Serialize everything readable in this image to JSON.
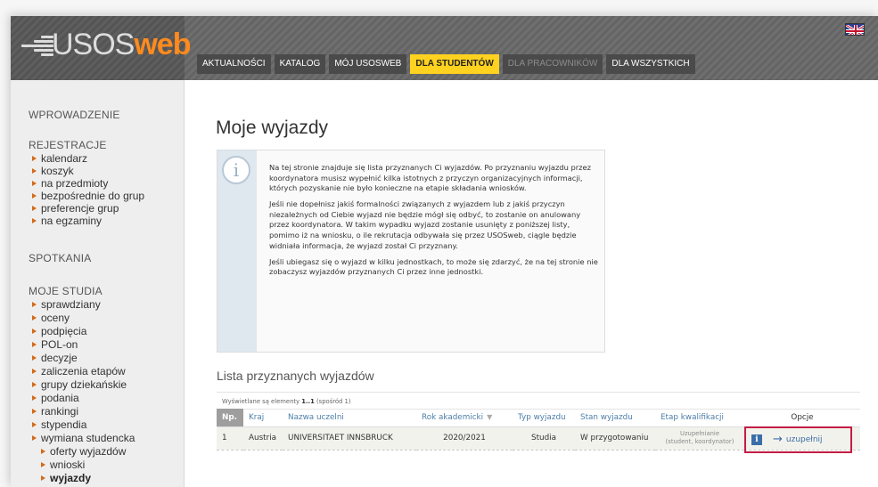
{
  "logo": {
    "part1": "USOS",
    "part2": "web"
  },
  "tabs": [
    {
      "label": "AKTUALNOŚCI",
      "state": "normal"
    },
    {
      "label": "KATALOG",
      "state": "normal"
    },
    {
      "label": "MÓJ USOSWEB",
      "state": "normal"
    },
    {
      "label": "DLA STUDENTÓW",
      "state": "active"
    },
    {
      "label": "DLA PRACOWNIKÓW",
      "state": "disabled"
    },
    {
      "label": "DLA WSZYSTKICH",
      "state": "normal"
    }
  ],
  "sidebar": {
    "wprowadzenie": "WPROWADZENIE",
    "rejestracje": {
      "heading": "REJESTRACJE",
      "items": [
        "kalendarz",
        "koszyk",
        "na przedmioty",
        "bezpośrednie do grup",
        "preferencje grup",
        "na egzaminy"
      ]
    },
    "spotkania": "SPOTKANIA",
    "moje_studia": {
      "heading": "MOJE STUDIA",
      "items": [
        "sprawdziany",
        "oceny",
        "podpięcia",
        "POL-on",
        "decyzje",
        "zaliczenia etapów",
        "grupy dziekańskie",
        "podania",
        "rankingi",
        "stypendia",
        "wymiana studencka"
      ],
      "subitems": [
        "oferty wyjazdów",
        "wnioski",
        "wyjazdy"
      ]
    }
  },
  "main": {
    "title": "Moje wyjazdy",
    "info": {
      "icon": "i",
      "paragraphs": [
        "Na tej stronie znajduje się lista przyznanych Ci wyjazdów. Po przyznaniu wyjazdu przez koordynatora musisz wypełnić kilka istotnych z przyczyn organizacyjnych informacji, których pozyskanie nie było konieczne na etapie składania wniosków.",
        "Jeśli nie dopełnisz jakiś formalności związanych z wyjazdem lub z jakiś przyczyn niezależnych od Ciebie wyjazd nie będzie mógł się odbyć, to zostanie on anulowany przez koordynatora. W takim wypadku wyjazd zostanie usunięty z poniższej listy, pomimo iż na wniosku, o ile rekrutacja odbywała się przez USOSweb, ciągle będzie widniała informacja, że wyjazd został Ci przyznany.",
        "Jeśli ubiegasz się o wyjazd w kilku jednostkach, to może się zdarzyć, że na tej stronie nie zobaczysz wyjazdów przyznanych Ci przez inne jednostki."
      ]
    },
    "list": {
      "title": "Lista przyznanych wyjazdów",
      "summary_prefix": "Wyświetlane są elementy ",
      "summary_range": "1..1",
      "summary_suffix": " (spośród 1)",
      "columns": {
        "np": "Np.",
        "kraj": "Kraj",
        "uczelnia": "Nazwa uczelni",
        "rok": "Rok akademicki",
        "typ": "Typ wyjazdu",
        "stan": "Stan wyjazdu",
        "etap": "Etap kwalifikacji",
        "opcje": "Opcje"
      },
      "row": {
        "np": "1",
        "kraj": "Austria",
        "uczelnia": "UNIVERSITAET INNSBRUCK",
        "rok": "2020/2021",
        "typ": "Studia",
        "stan": "W przygotowaniu",
        "etap_line1": "Uzupełnianie",
        "etap_line2": "(student, koordynator)",
        "info_icon": "i",
        "action_label": "uzupełnij"
      }
    }
  },
  "colors": {
    "active_tab": "#ffd21f",
    "logo_web": "#ff8a1e",
    "highlight_border": "#c41c45",
    "link": "#3b6ea8"
  }
}
